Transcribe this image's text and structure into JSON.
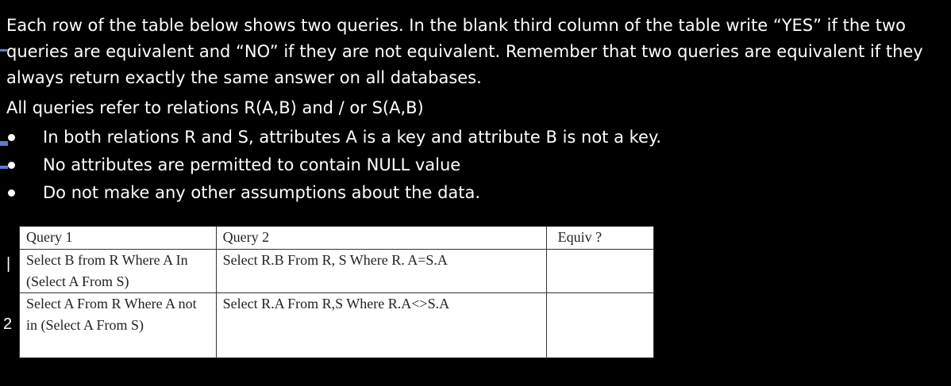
{
  "paragraphs": {
    "p1": "Each row of the table below shows two queries. In the blank third column of the table write “YES” if the two queries are equivalent and “NO” if they are not equivalent. Remember that two queries are equivalent if they always return exactly the same answer on all databases.",
    "p2": "All queries refer to relations R(A,B) and / or S(A,B)"
  },
  "bullets": [
    "In both relations R and S, attributes A is a key and attribute B is not a key.",
    "No attributes are permitted to contain NULL value",
    "Do not make any other assumptions about the data."
  ],
  "table": {
    "headers": [
      "Query 1",
      "Query 2",
      "Equiv ?"
    ],
    "rows": [
      {
        "q1": "Select B from R Where A In (Select A From S)",
        "q2": "Select R.B From R, S Where R. A=S.A",
        "equiv": ""
      },
      {
        "q1": "Select A From R Where A not in (Select A From S)",
        "q2": "Select R.A From R,S Where R.A<>S.A",
        "equiv": ""
      }
    ]
  },
  "annotations": {
    "row1": "|",
    "row2": "2"
  }
}
